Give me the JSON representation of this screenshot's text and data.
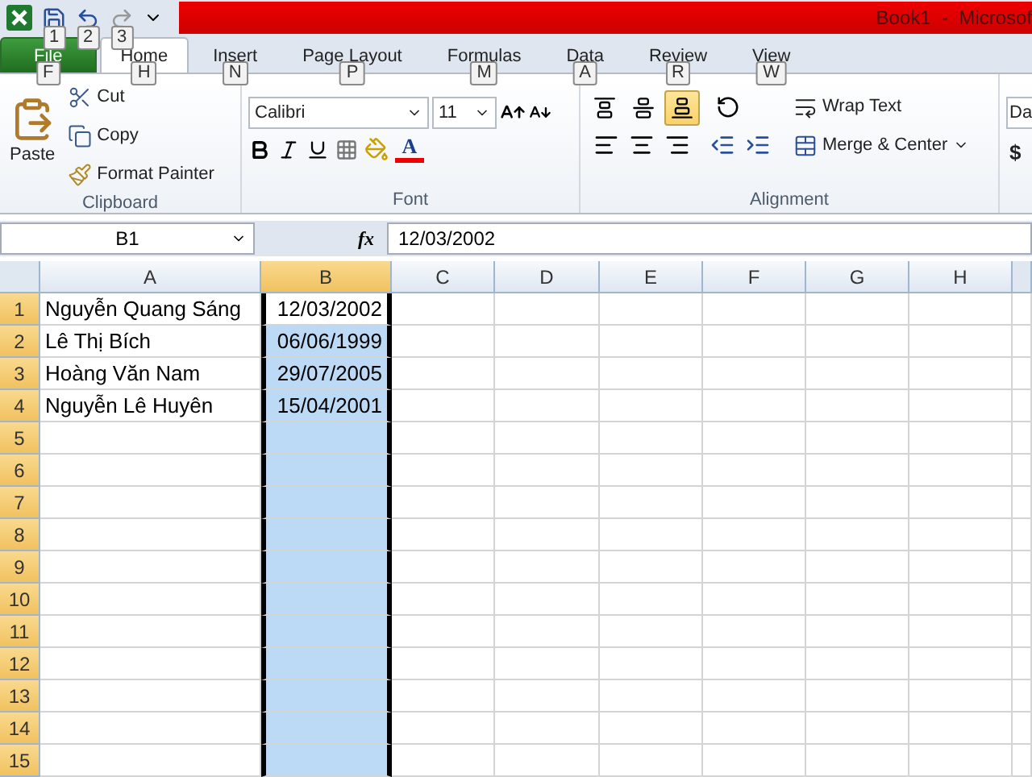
{
  "title_bar": {
    "quick_access_keytips": [
      "1",
      "2",
      "3"
    ],
    "title": "Book1  -  Microsof"
  },
  "tabs": [
    {
      "label": "File",
      "keytip": "F",
      "kind": "file",
      "selected": false
    },
    {
      "label": "Home",
      "keytip": "H",
      "kind": "tab",
      "selected": true
    },
    {
      "label": "Insert",
      "keytip": "N",
      "kind": "tab",
      "selected": false
    },
    {
      "label": "Page Layout",
      "keytip": "P",
      "kind": "tab",
      "selected": false
    },
    {
      "label": "Formulas",
      "keytip": "M",
      "kind": "tab",
      "selected": false
    },
    {
      "label": "Data",
      "keytip": "A",
      "kind": "tab",
      "selected": false
    },
    {
      "label": "Review",
      "keytip": "R",
      "kind": "tab",
      "selected": false
    },
    {
      "label": "View",
      "keytip": "W",
      "kind": "tab",
      "selected": false
    }
  ],
  "clipboard": {
    "paste": "Paste",
    "cut": "Cut",
    "copy": "Copy",
    "format_painter": "Format Painter",
    "label": "Clipboard"
  },
  "font": {
    "font_name": "Calibri",
    "font_size": "11",
    "font_color_letter": "A",
    "label": "Font"
  },
  "alignment": {
    "vertical_buttons": [
      {
        "selected": false
      },
      {
        "selected": false
      },
      {
        "selected": true
      }
    ],
    "wrap_text": "Wrap Text",
    "merge_center": "Merge & Center",
    "label": "Alignment"
  },
  "number": {
    "format": "Da",
    "currency": "$"
  },
  "formula_bar": {
    "name_box": "B1",
    "function_label": "fx",
    "value": "12/03/2002"
  },
  "sheet": {
    "columns": [
      {
        "label": "A",
        "selected": false
      },
      {
        "label": "B",
        "selected": true
      },
      {
        "label": "C",
        "selected": false
      },
      {
        "label": "D",
        "selected": false
      },
      {
        "label": "E",
        "selected": false
      },
      {
        "label": "F",
        "selected": false
      },
      {
        "label": "G",
        "selected": false
      },
      {
        "label": "H",
        "selected": false
      }
    ],
    "rows": [
      {
        "label": "1",
        "selected": true,
        "cells": [
          {
            "text": "Nguyễn Quang Sáng",
            "active": false
          },
          {
            "text": "12/03/2002",
            "active": true
          }
        ]
      },
      {
        "label": "2",
        "selected": true,
        "cells": [
          {
            "text": "Lê Thị Bích",
            "active": false
          },
          {
            "text": "06/06/1999",
            "active": false
          }
        ]
      },
      {
        "label": "3",
        "selected": true,
        "cells": [
          {
            "text": "Hoàng Văn Nam",
            "active": false
          },
          {
            "text": "29/07/2005",
            "active": false
          }
        ]
      },
      {
        "label": "4",
        "selected": true,
        "cells": [
          {
            "text": "Nguyễn Lê Huyên",
            "active": false
          },
          {
            "text": "15/04/2001",
            "active": false
          }
        ]
      },
      {
        "label": "5",
        "selected": true
      },
      {
        "label": "6",
        "selected": true
      },
      {
        "label": "7",
        "selected": true
      },
      {
        "label": "8",
        "selected": true
      },
      {
        "label": "9",
        "selected": true
      },
      {
        "label": "10",
        "selected": true
      },
      {
        "label": "11",
        "selected": true
      },
      {
        "label": "12",
        "selected": true
      },
      {
        "label": "13",
        "selected": true
      },
      {
        "label": "14",
        "selected": true
      },
      {
        "label": "15",
        "selected": true
      }
    ]
  }
}
